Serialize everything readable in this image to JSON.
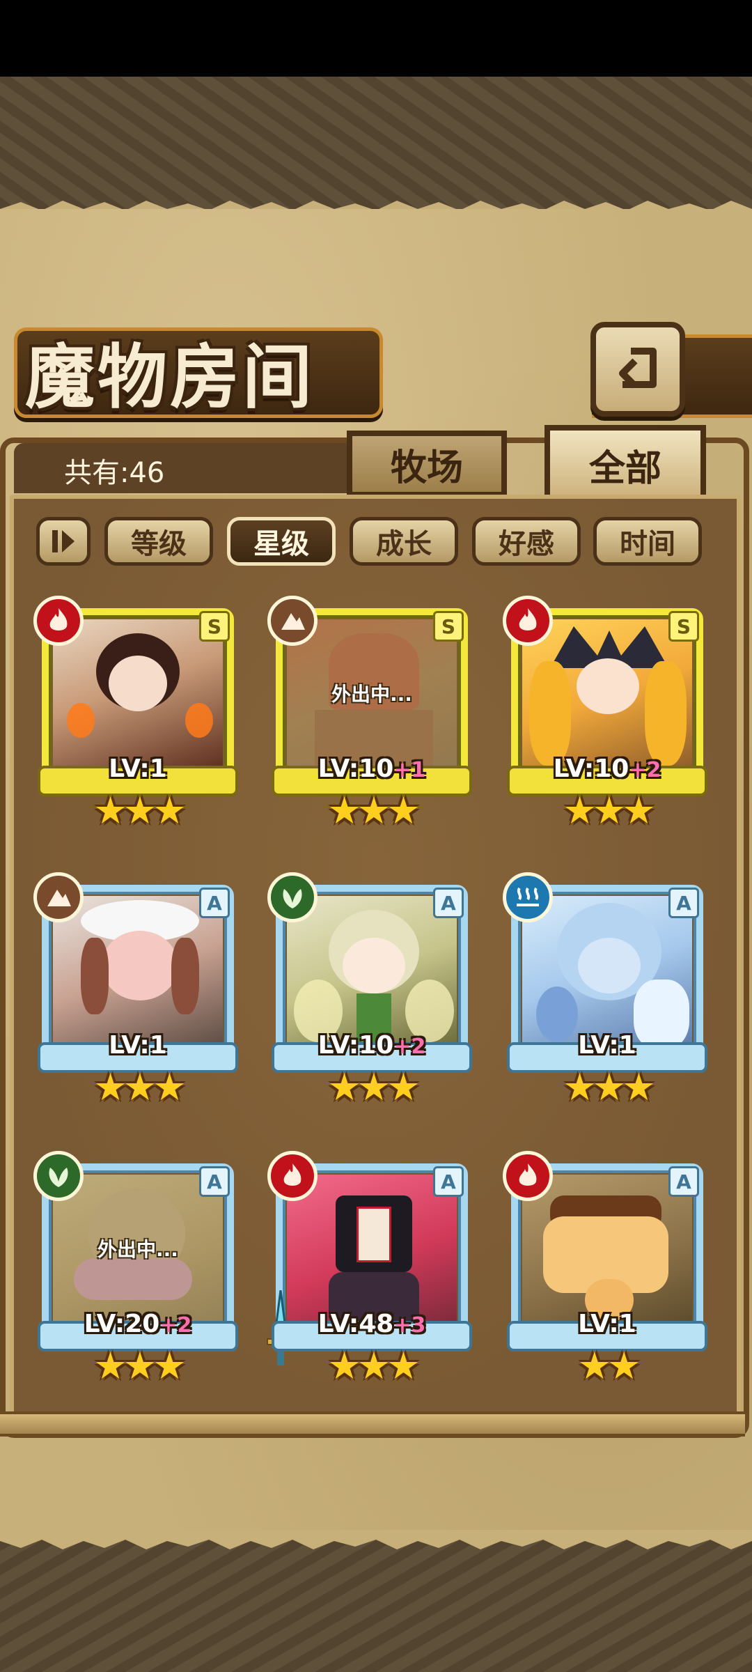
{
  "header": {
    "title": "魔物房间",
    "back_icon": "return-arrow-icon"
  },
  "summary": {
    "count_text": "共有:46"
  },
  "tabs": [
    {
      "label": "牧场",
      "active": false
    },
    {
      "label": "全部",
      "active": true
    }
  ],
  "sort": {
    "toggle_icon": "sort-toggle-icon",
    "buttons": [
      {
        "label": "等级",
        "active": false
      },
      {
        "label": "星级",
        "active": true
      },
      {
        "label": "成长",
        "active": false
      },
      {
        "label": "好感",
        "active": false
      },
      {
        "label": "时间",
        "active": false
      }
    ]
  },
  "monsters": [
    {
      "element": "fire",
      "rank": "S",
      "level": "LV:1",
      "plus": "",
      "stars": "★★★",
      "away": "",
      "frame": "gold"
    },
    {
      "element": "earth",
      "rank": "S",
      "level": "LV:10",
      "plus": "+1",
      "stars": "★★★",
      "away": "外出中...",
      "frame": "gold"
    },
    {
      "element": "fire",
      "rank": "S",
      "level": "LV:10",
      "plus": "+2",
      "stars": "★★★",
      "away": "",
      "frame": "gold"
    },
    {
      "element": "earth",
      "rank": "A",
      "level": "LV:1",
      "plus": "",
      "stars": "★★★",
      "away": "",
      "frame": "blue"
    },
    {
      "element": "leaf",
      "rank": "A",
      "level": "LV:10",
      "plus": "+2",
      "stars": "★★★",
      "away": "",
      "frame": "blue"
    },
    {
      "element": "water",
      "rank": "A",
      "level": "LV:1",
      "plus": "",
      "stars": "★★★",
      "away": "",
      "frame": "blue"
    },
    {
      "element": "leaf",
      "rank": "A",
      "level": "LV:20",
      "plus": "+2",
      "stars": "★★★",
      "away": "外出中...",
      "frame": "blue"
    },
    {
      "element": "fire",
      "rank": "A",
      "level": "LV:48",
      "plus": "+3",
      "stars": "★★★",
      "away": "",
      "frame": "blue"
    },
    {
      "element": "fire",
      "rank": "A",
      "level": "LV:1",
      "plus": "",
      "stars": "★★",
      "away": "",
      "frame": "blue"
    }
  ]
}
